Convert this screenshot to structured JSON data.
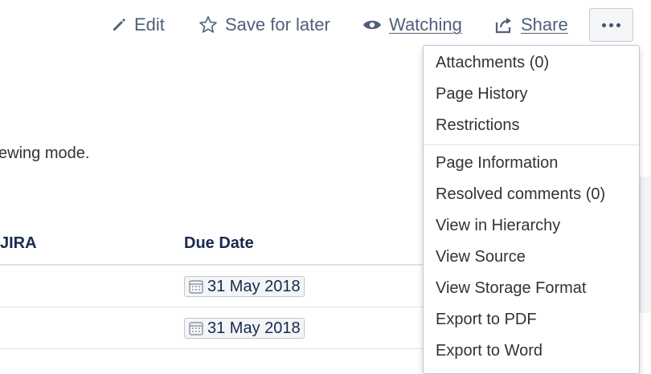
{
  "toolbar": {
    "edit_label": "Edit",
    "save_label": "Save for later",
    "watching_label": "Watching",
    "share_label": "Share",
    "more_icon": "more-horizontal-icon"
  },
  "page": {
    "note_text": "ewing mode."
  },
  "table": {
    "headers": [
      "JIRA",
      "Due Date"
    ],
    "rows": [
      {
        "due_date": "31 May 2018"
      },
      {
        "due_date": "31 May 2018"
      }
    ]
  },
  "menu": {
    "group1": [
      "Attachments (0)",
      "Page History",
      "Restrictions"
    ],
    "group2": [
      "Page Information",
      "Resolved comments (0)",
      "View in Hierarchy",
      "View Source",
      "View Storage Format",
      "Export to PDF",
      "Export to Word"
    ]
  },
  "colors": {
    "toolbar_text": "#505f79",
    "menu_border": "#c1c7d0",
    "divider": "#dfe1e6"
  }
}
